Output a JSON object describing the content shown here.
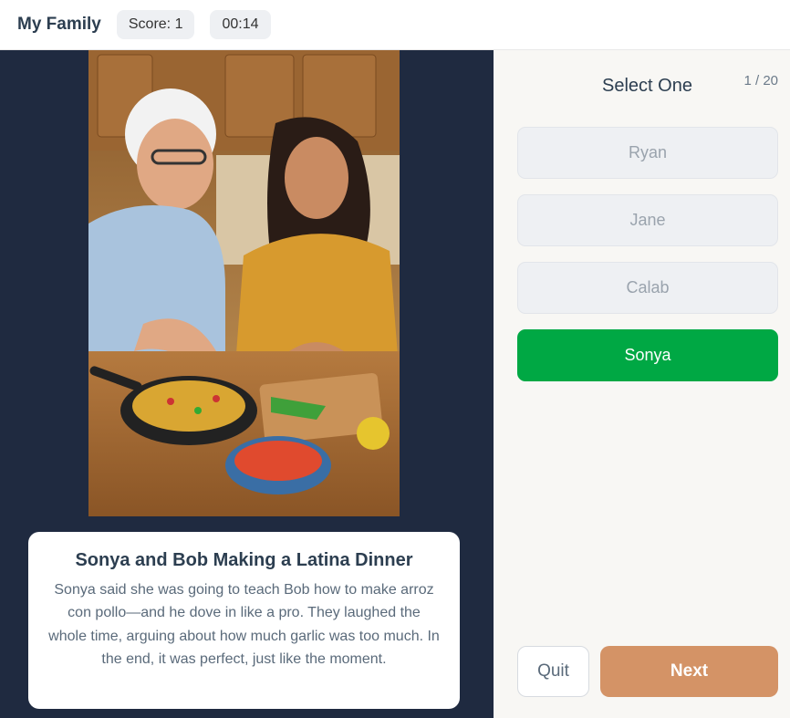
{
  "header": {
    "title": "My Family",
    "score": "Score: 1",
    "timer": "00:14"
  },
  "photo": {
    "subject": "two-people-cooking-photo"
  },
  "caption": {
    "title": "Sonya and Bob Making a Latina Dinner",
    "body": "Sonya said she was going to teach Bob how to make arroz con pollo—and he dove in like a pro. They laughed the whole time, arguing about how much garlic was too much. In the end, it was perfect, just like the moment."
  },
  "quiz": {
    "prompt": "Select One",
    "progress": "1 / 20",
    "options": [
      {
        "label": "Ryan"
      },
      {
        "label": "Jane"
      },
      {
        "label": "Calab"
      },
      {
        "label": "Sonya",
        "selected": true
      }
    ]
  },
  "actions": {
    "quit": "Quit",
    "next": "Next"
  },
  "colors": {
    "selected": "#00a844",
    "next": "#d49366",
    "left_panel": "#1f2a40"
  }
}
